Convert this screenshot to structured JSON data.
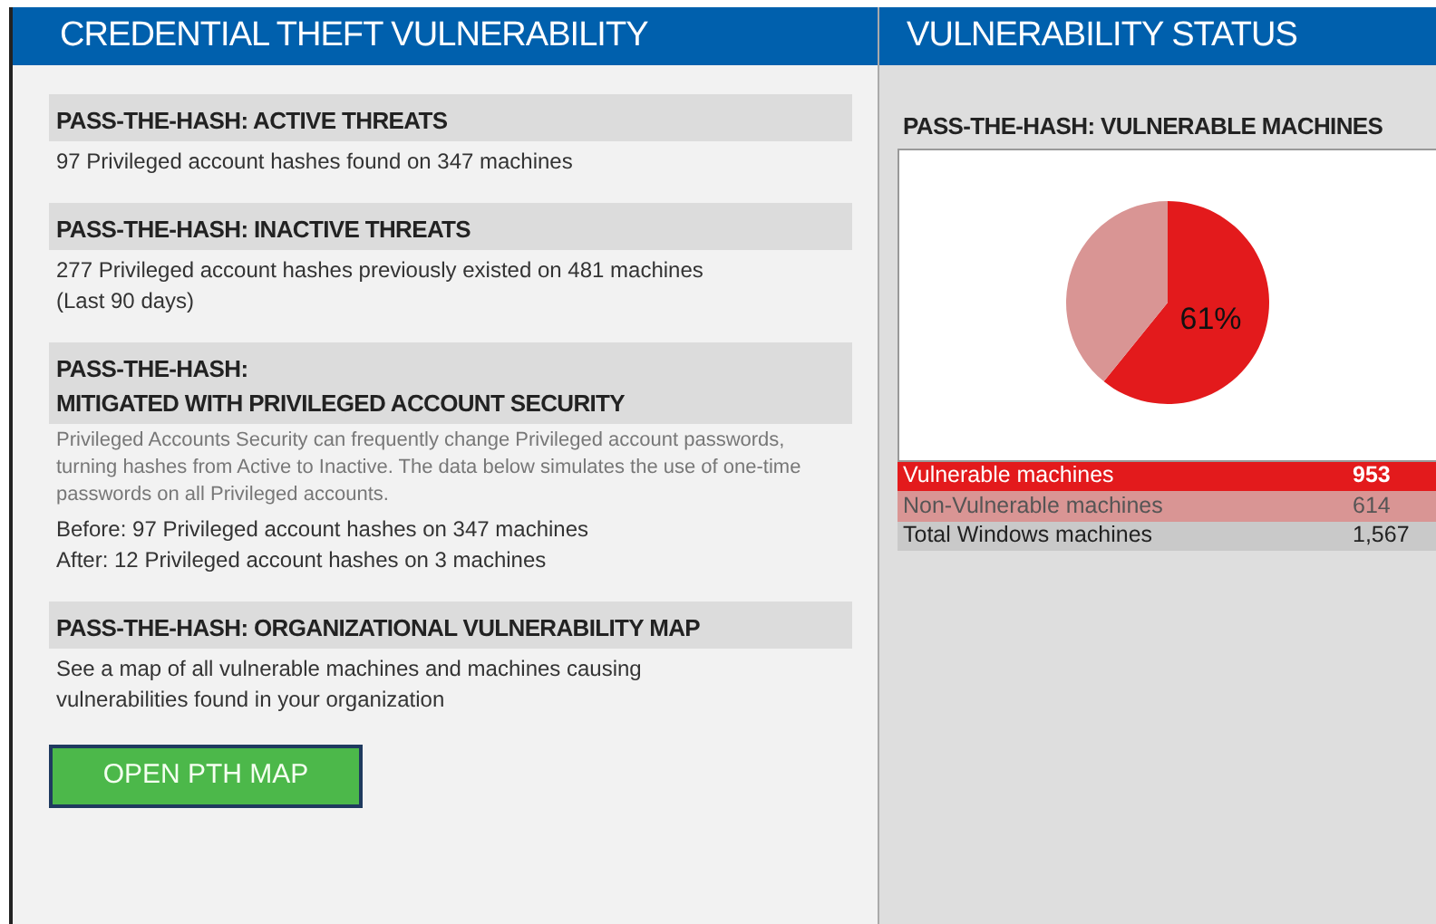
{
  "left_panel": {
    "title": "CREDENTIAL THEFT VULNERABILITY",
    "sections": [
      {
        "heading": [
          "PASS-THE-HASH: ACTIVE THREATS"
        ],
        "lines": [
          "97 Privileged account hashes found on 347 machines"
        ]
      },
      {
        "heading": [
          "PASS-THE-HASH: INACTIVE THREATS"
        ],
        "lines": [
          "277 Privileged account hashes previously existed on 481 machines",
          "(Last 90 days)"
        ]
      },
      {
        "heading": [
          "PASS-THE-HASH:",
          "MITIGATED WITH PRIVILEGED ACCOUNT SECURITY"
        ],
        "note": "Privileged Accounts Security can frequently change Privileged account passwords, turning hashes from Active to Inactive. The data below simulates the use of one-time passwords on all Privileged accounts.",
        "lines": [
          "Before: 97 Privileged account hashes on 347 machines",
          "After: 12 Privileged account hashes on 3 machines"
        ]
      },
      {
        "heading": [
          "PASS-THE-HASH: ORGANIZATIONAL VULNERABILITY MAP"
        ],
        "lines": [
          "See a map of all vulnerable machines and machines causing",
          "vulnerabilities found in your organization"
        ]
      }
    ],
    "button": "OPEN PTH MAP"
  },
  "right_panel": {
    "title": "VULNERABILITY STATUS",
    "chart_title": "PASS-THE-HASH: VULNERABLE MACHINES",
    "pie_label": "61%",
    "rows": [
      {
        "label": "Vulnerable machines",
        "value": "953",
        "color": "#e31a1c"
      },
      {
        "label": "Non-Vulnerable machines",
        "value": "614",
        "color": "#d99594"
      },
      {
        "label": "Total Windows machines",
        "value": "1,567",
        "color": "#c9c9c9"
      }
    ]
  }
}
